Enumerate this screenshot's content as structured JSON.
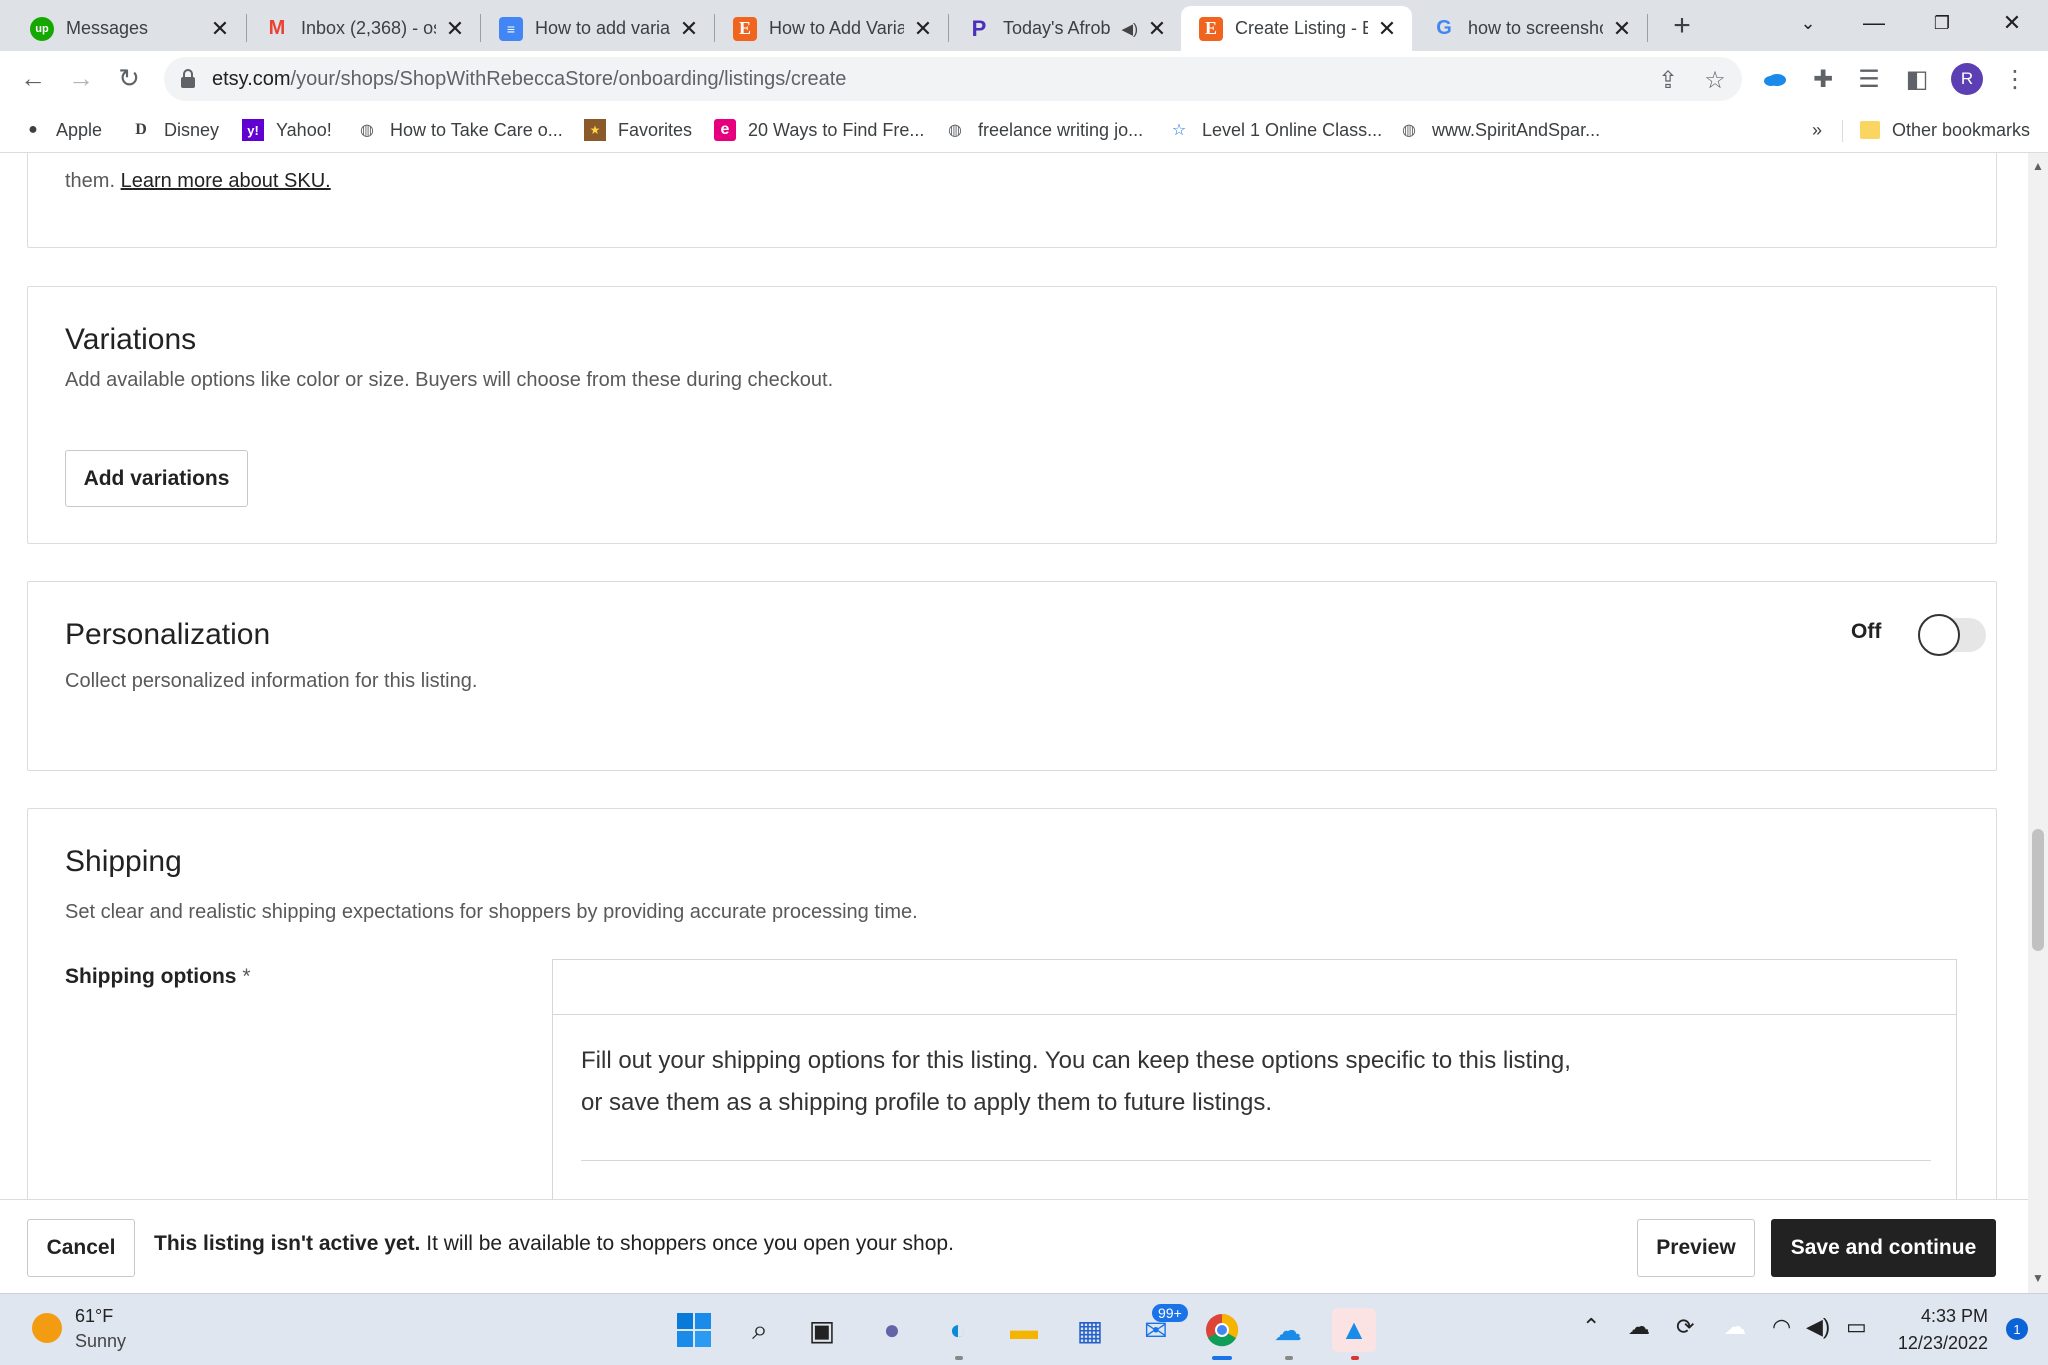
{
  "browser": {
    "tabs": [
      {
        "title": "Messages",
        "favicon": "upwork-icon",
        "favicon_text": "up",
        "favicon_color": "#14a800"
      },
      {
        "title": "Inbox (2,368) - os",
        "favicon": "gmail-icon",
        "favicon_text": "M",
        "favicon_color": "#ea4335"
      },
      {
        "title": "How to add varia",
        "favicon": "google-docs-icon",
        "favicon_text": "≡",
        "favicon_color": "#4285f4"
      },
      {
        "title": "How to Add Varia",
        "favicon": "etsy-icon",
        "favicon_text": "E",
        "favicon_color": "#f1641e"
      },
      {
        "title": "Today's Afrob",
        "favicon": "pandora-icon",
        "favicon_text": "P",
        "favicon_color": "#4b2fbd"
      },
      {
        "title": "Create Listing - E",
        "favicon": "etsy-icon",
        "favicon_text": "E",
        "favicon_color": "#f1641e"
      },
      {
        "title": "how to screensho",
        "favicon": "google-icon",
        "favicon_text": "G",
        "favicon_color": "#4285f4"
      }
    ],
    "active_tab": 5,
    "new_tab_label": "+",
    "url_host": "etsy.com",
    "url_path": "/your/shops/ShopWithRebeccaStore/onboarding/listings/create",
    "profile_initial": "R",
    "bookmarks": [
      {
        "label": "Apple",
        "icon": "apple-icon"
      },
      {
        "label": "Disney",
        "icon": "disney-icon"
      },
      {
        "label": "Yahoo!",
        "icon": "yahoo-icon"
      },
      {
        "label": "How to Take Care o...",
        "icon": "globe-icon"
      },
      {
        "label": "Favorites",
        "icon": "favorites-icon"
      },
      {
        "label": "20 Ways to Find Fre...",
        "icon": "e-icon"
      },
      {
        "label": "freelance writing jo...",
        "icon": "globe-icon"
      },
      {
        "label": "Level 1 Online Class...",
        "icon": "star-icon"
      },
      {
        "label": "www.SpiritAndSpar...",
        "icon": "globe-icon"
      }
    ],
    "bookmarks_overflow": "»",
    "other_bookmarks": "Other bookmarks"
  },
  "sku": {
    "text": "them.",
    "link": "Learn more about SKU."
  },
  "variations": {
    "title": "Variations",
    "description": "Add available options like color or size. Buyers will choose from these during checkout.",
    "button": "Add variations"
  },
  "personalization": {
    "title": "Personalization",
    "description": "Collect personalized information for this listing.",
    "toggle_label": "Off"
  },
  "shipping": {
    "title": "Shipping",
    "description": "Set clear and realistic shipping expectations for shoppers by providing accurate processing time.",
    "options_label": "Shipping options",
    "required_mark": "*",
    "info_text": "Fill out your shipping options for this listing. You can keep these options specific to this listing, or save them as a shipping profile to apply them to future listings."
  },
  "footer": {
    "cancel": "Cancel",
    "status_bold": "This listing isn't active yet.",
    "status_rest": "It will be available to shoppers once you open your shop.",
    "preview": "Preview",
    "save": "Save and continue"
  },
  "taskbar": {
    "temperature": "61°F",
    "condition": "Sunny",
    "mail_badge": "99+",
    "time": "4:33 PM",
    "date": "12/23/2022",
    "notifications": "1"
  }
}
